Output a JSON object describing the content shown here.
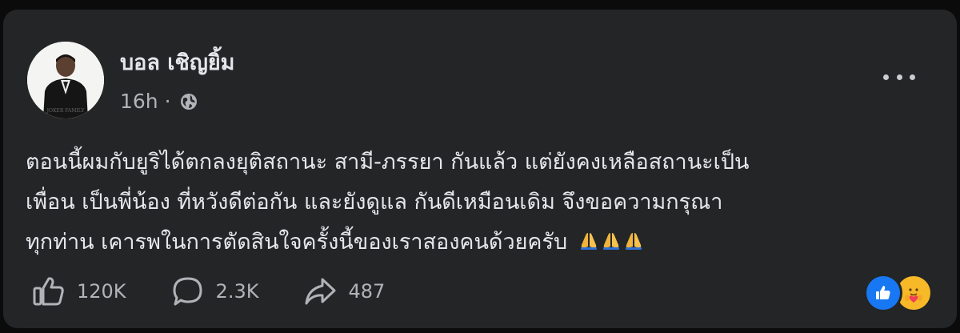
{
  "post": {
    "author": "บอล เชิญยิ้ม",
    "time": "16h",
    "separator": "·",
    "privacy_icon": "globe-icon",
    "more_icon": "more-options-icon",
    "text_lines": [
      "ตอนนี้ผมกับยูริได้ตกลงยุติสถานะ สามี-ภรรยา กันแล้ว แต่ยังคงเหลือสถานะเป็น",
      "เพื่อน เป็นพี่น้อง ที่หวังดีต่อกัน และยังดูแล กันดีเหมือนเดิม จึงขอความกรุณา",
      "ทุกท่าน เคารพในการตัดสินใจครั้งนี้ของเราสองคนด้วยครับ"
    ],
    "emoji": [
      "🙏",
      "🙏",
      "🙏"
    ]
  },
  "stats": {
    "likes": "120K",
    "comments": "2.3K",
    "shares": "487"
  },
  "reactions": [
    "like-reaction-icon",
    "care-reaction-icon"
  ],
  "colors": {
    "card_bg": "#242526",
    "text": "#e4e6eb",
    "secondary_text": "#b0b3b8",
    "like_blue": "#1877f2",
    "care_yellow": "#f7b928"
  }
}
